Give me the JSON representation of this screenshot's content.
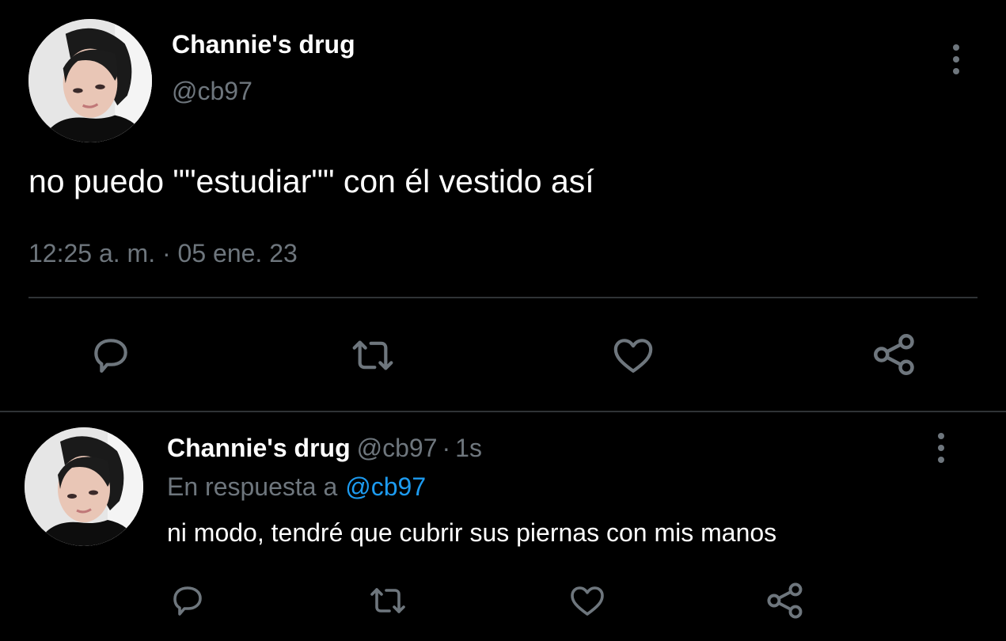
{
  "main_tweet": {
    "display_name": "Channie's drug",
    "handle": "@cb97",
    "text": "no puedo \"\"estudiar\"\" con él vestido así",
    "timestamp": "12:25 a. m. · 05 ene. 23",
    "actions": [
      "reply-icon",
      "retweet-icon",
      "like-icon",
      "share-icon"
    ]
  },
  "reply_tweet": {
    "display_name": "Channie's drug",
    "handle": "@cb97",
    "separator": "·",
    "time_ago": "1s",
    "reply_prefix": "En respuesta a",
    "reply_mention": "@cb97",
    "text": "ni modo, tendré que cubrir sus piernas con mis manos",
    "actions": [
      "reply-icon",
      "retweet-icon",
      "like-icon",
      "share-icon"
    ]
  },
  "colors": {
    "background": "#000000",
    "primary_text": "#ffffff",
    "secondary_text": "#6e767d",
    "mention": "#1d9bf0",
    "divider": "#2f3336",
    "icon": "#6e767d"
  }
}
